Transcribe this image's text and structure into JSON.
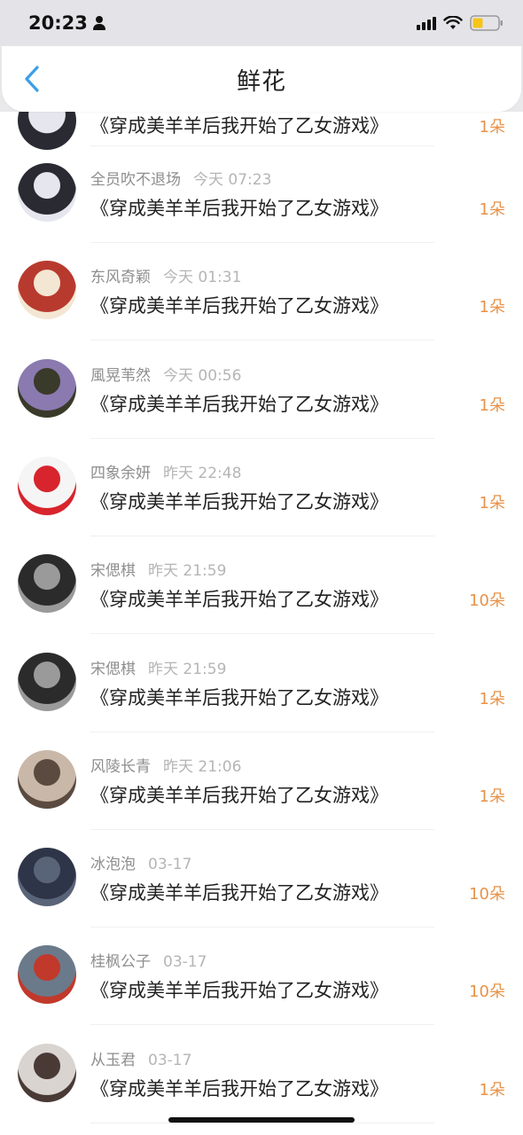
{
  "status_bar": {
    "time": "20:23"
  },
  "header": {
    "title": "鲜花"
  },
  "partial_item": {
    "title": "《穿成美羊羊后我开始了乙女游戏》",
    "count": "1朵"
  },
  "items": [
    {
      "name": "全员吹不退场",
      "time": "今天 07:23",
      "title": "《穿成美羊羊后我开始了乙女游戏》",
      "count": "1朵",
      "avatar_colors": [
        "#2a2a33",
        "#e6e6ee"
      ]
    },
    {
      "name": "东风奇颖",
      "time": "今天 01:31",
      "title": "《穿成美羊羊后我开始了乙女游戏》",
      "count": "1朵",
      "avatar_colors": [
        "#b83a2e",
        "#f3e6d2"
      ]
    },
    {
      "name": "風晃苇然",
      "time": "今天 00:56",
      "title": "《穿成美羊羊后我开始了乙女游戏》",
      "count": "1朵",
      "avatar_colors": [
        "#8a7ab0",
        "#3a3a2a"
      ]
    },
    {
      "name": "四象余妍",
      "time": "昨天 22:48",
      "title": "《穿成美羊羊后我开始了乙女游戏》",
      "count": "1朵",
      "avatar_colors": [
        "#f5f5f5",
        "#d8242c"
      ]
    },
    {
      "name": "宋偲棋",
      "time": "昨天 21:59",
      "title": "《穿成美羊羊后我开始了乙女游戏》",
      "count": "10朵",
      "avatar_colors": [
        "#2b2b2b",
        "#9a9a9a"
      ]
    },
    {
      "name": "宋偲棋",
      "time": "昨天 21:59",
      "title": "《穿成美羊羊后我开始了乙女游戏》",
      "count": "1朵",
      "avatar_colors": [
        "#2b2b2b",
        "#9a9a9a"
      ]
    },
    {
      "name": "风陵长青",
      "time": "昨天 21:06",
      "title": "《穿成美羊羊后我开始了乙女游戏》",
      "count": "1朵",
      "avatar_colors": [
        "#c9b8a8",
        "#5a4a40"
      ]
    },
    {
      "name": "冰泡泡",
      "time": "03-17",
      "title": "《穿成美羊羊后我开始了乙女游戏》",
      "count": "10朵",
      "avatar_colors": [
        "#2e3548",
        "#5a6478"
      ]
    },
    {
      "name": "桂枫公子",
      "time": "03-17",
      "title": "《穿成美羊羊后我开始了乙女游戏》",
      "count": "10朵",
      "avatar_colors": [
        "#6a7a8a",
        "#c0392b"
      ]
    },
    {
      "name": "从玉君",
      "time": "03-17",
      "title": "《穿成美羊羊后我开始了乙女游戏》",
      "count": "1朵",
      "avatar_colors": [
        "#d9d4d0",
        "#4a3a36"
      ]
    }
  ],
  "colors": {
    "accent_blue": "#3a9ee8",
    "count_orange": "#e8924a",
    "meta_gray": "#9a9a9a"
  },
  "icons": [
    "person-icon",
    "signal-icon",
    "wifi-icon",
    "battery-icon",
    "back-arrow-icon"
  ]
}
